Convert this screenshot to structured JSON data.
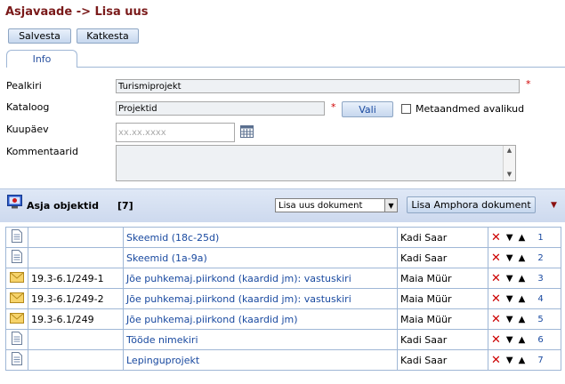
{
  "header": {
    "title": "Asjavaade -> Lisa uus"
  },
  "toolbar": {
    "save_label": "Salvesta",
    "cancel_label": "Katkesta"
  },
  "tabs": [
    {
      "label": "Info"
    }
  ],
  "form": {
    "title_label": "Pealkiri",
    "title_value": "Turismiprojekt",
    "catalog_label": "Kataloog",
    "catalog_value": "Projektid",
    "choose_button": "Vali",
    "metadata_public_label": "Metaandmed avalikud",
    "date_label": "Kuupäev",
    "date_placeholder": "xx.xx.xxxx",
    "comments_label": "Kommentaarid",
    "required_mark": "*"
  },
  "objects": {
    "heading": "Asja objektid",
    "count": "[7]",
    "add_select_value": "Lisa uus dokument",
    "amphora_button": "Lisa Amphora dokument",
    "rows": [
      {
        "icon": "document-icon",
        "code": "",
        "title": "Skeemid (18c-25d)",
        "person": "Kadi Saar",
        "order": "1"
      },
      {
        "icon": "document-icon",
        "code": "",
        "title": "Skeemid (1a-9a)",
        "person": "Kadi Saar",
        "order": "2"
      },
      {
        "icon": "envelope-icon",
        "code": "19.3-6.1/249-1",
        "title": "Jõe puhkemaj.piirkond (kaardid jm): vastuskiri",
        "person": "Maia Müür",
        "order": "3"
      },
      {
        "icon": "envelope-icon",
        "code": "19.3-6.1/249-2",
        "title": "Jõe puhkemaj.piirkond (kaardid jm): vastuskiri",
        "person": "Maia Müür",
        "order": "4"
      },
      {
        "icon": "envelope-icon",
        "code": "19.3-6.1/249",
        "title": "Jõe puhkemaj.piirkond (kaardid jm)",
        "person": "Maia Müür",
        "order": "5"
      },
      {
        "icon": "document-icon",
        "code": "",
        "title": "Tööde nimekiri",
        "person": "Kadi Saar",
        "order": "6"
      },
      {
        "icon": "document-icon",
        "code": "",
        "title": "Lepinguprojekt",
        "person": "Kadi Saar",
        "order": "7"
      }
    ]
  },
  "colors": {
    "title": "#7a1a1a",
    "link": "#1a4aa0",
    "required": "#d00000",
    "delete": "#cc0000"
  }
}
